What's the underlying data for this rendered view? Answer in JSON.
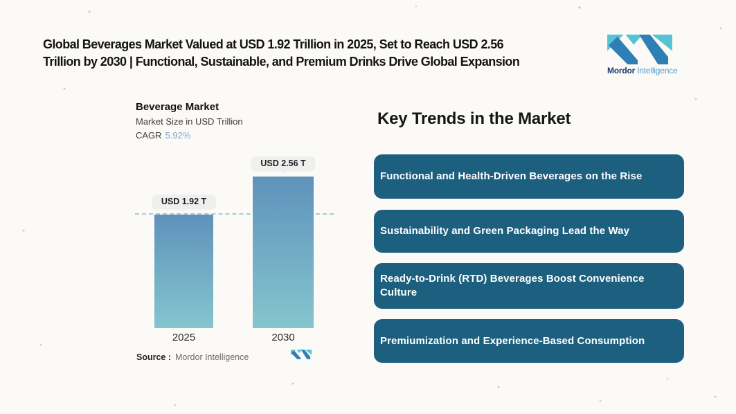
{
  "header": {
    "title_lines": [
      "Global Beverages Market Valued at USD 1.92 Trillion in 2025, Set to Reach USD 2.56",
      "Trillion by 2030 | Functional, Sustainable, and Premium Drinks Drive Global Expansion"
    ],
    "brand": {
      "name_bold": "Mordor",
      "name_light": "Intelligence"
    }
  },
  "chart": {
    "title": "Beverage Market",
    "subtitle": "Market Size in USD Trillion",
    "cagr_label": "CAGR",
    "cagr_value": "5.92%",
    "source_label": "Source :",
    "source_value": "Mordor Intelligence"
  },
  "chart_data": {
    "type": "bar",
    "title": "Beverage Market",
    "ylabel": "Market Size in USD Trillion",
    "unit": "USD Trillion",
    "categories": [
      "2025",
      "2030"
    ],
    "values": [
      1.92,
      2.56
    ],
    "value_labels": [
      "USD 1.92 T",
      "USD 2.56 T"
    ],
    "cagr": "5.92%",
    "reference_line": 1.92,
    "ylim": [
      0,
      2.8
    ],
    "grid": false,
    "legend": "none"
  },
  "trends": {
    "heading": "Key Trends in the Market",
    "items": [
      "Functional and Health-Driven Beverages on the Rise",
      "Sustainability and Green Packaging Lead the Way",
      "Ready-to-Drink (RTD) Beverages Boost Convenience Culture",
      "Premiumization and Experience-Based Consumption"
    ]
  },
  "colors": {
    "background": "#fbfaf6",
    "headline_text": "#141414",
    "card_bg": "#1d5f7f",
    "card_text": "#ffffff",
    "bar_top": "#5f92bb",
    "bar_bottom": "#84c6ce",
    "dash_line": "#a5cbdc",
    "cagr_value": "#7fa7cd",
    "callout_bg": "#edf0ee",
    "brand_teal": "#56c3d3",
    "brand_blue": "#2e7fb5",
    "brand_navy": "#1d3a6d",
    "brand_light_blue": "#4d9ed2",
    "source_value_text": "#6a6a6a"
  }
}
